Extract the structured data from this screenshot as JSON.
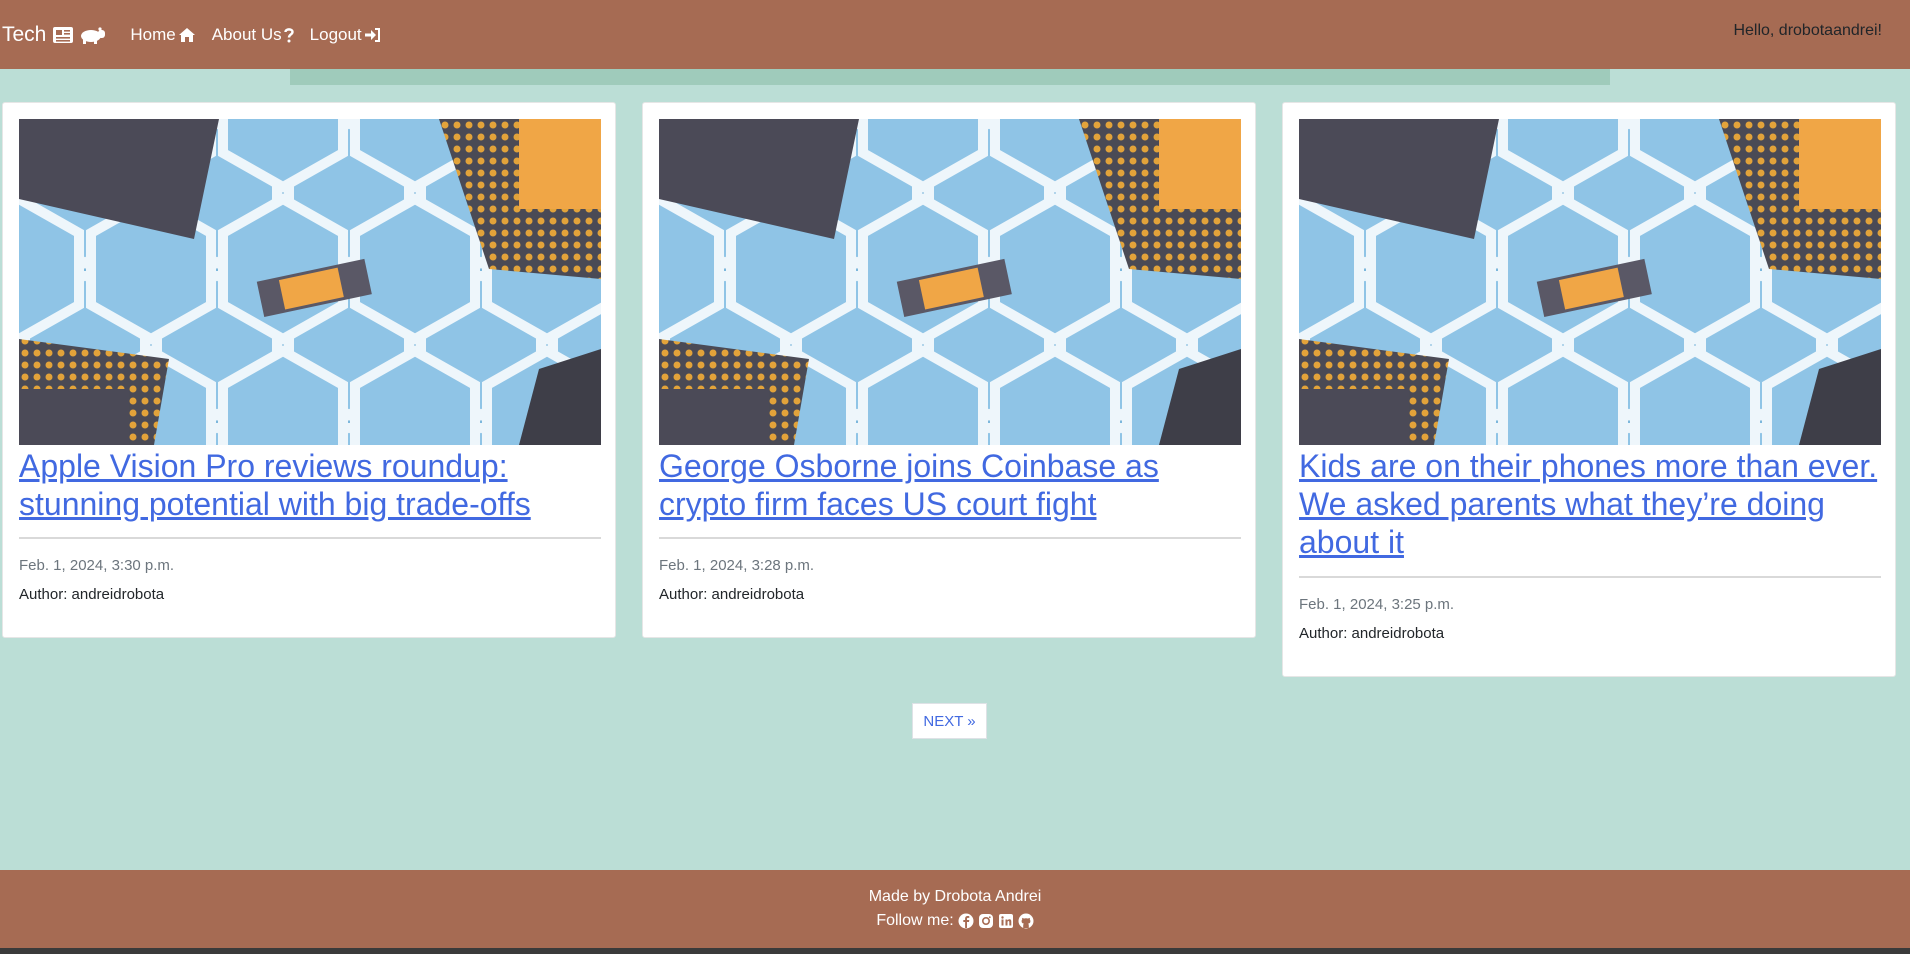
{
  "navbar": {
    "brand": "Tech",
    "brand_icons": [
      "newspaper-icon",
      "hippo-icon"
    ],
    "links": [
      {
        "label": "Home",
        "icon": "home-icon"
      },
      {
        "label": "About Us",
        "icon": "question-icon"
      },
      {
        "label": "Logout",
        "icon": "sign-in-icon"
      }
    ],
    "greeting": "Hello, drobotaandrei!"
  },
  "posts": [
    {
      "title": "Apple Vision Pro reviews roundup: stunning potential with big trade-offs",
      "date": "Feb. 1, 2024, 3:30 p.m.",
      "author": "Author: andreidrobota"
    },
    {
      "title": "George Osborne joins Coinbase as crypto firm faces US court fight",
      "date": "Feb. 1, 2024, 3:28 p.m.",
      "author": "Author: andreidrobota"
    },
    {
      "title": "Kids are on their phones more than ever. We asked parents what they’re doing about it",
      "date": "Feb. 1, 2024, 3:25 p.m.",
      "author": "Author: andreidrobota"
    }
  ],
  "pagination": {
    "next": "NEXT »"
  },
  "footer": {
    "made_by": "Made by Drobota Andrei",
    "follow": "Follow me:",
    "social": [
      "facebook-icon",
      "instagram-icon",
      "linkedin-icon",
      "github-icon"
    ]
  },
  "colors": {
    "navbar": "#a66b53",
    "background": "#bbded6",
    "link": "#4169e1"
  }
}
